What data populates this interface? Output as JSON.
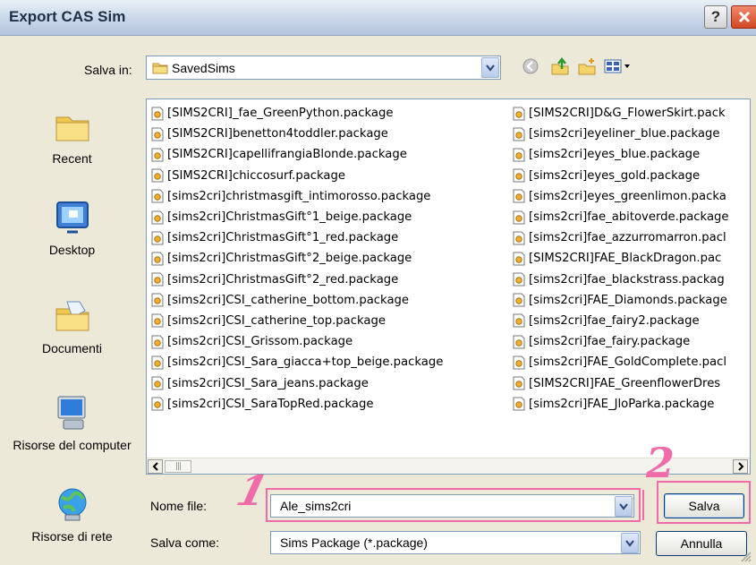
{
  "window": {
    "title": "Export CAS Sim",
    "help_label": "?",
    "close_label": "✕"
  },
  "save_in": {
    "label": "Salva in:",
    "value": "SavedSims"
  },
  "nav_icons": [
    "back-icon",
    "up-folder-icon",
    "new-folder-icon",
    "views-menu-icon"
  ],
  "places": [
    {
      "id": "recent",
      "label": "Recent",
      "icon": "recent-folder-icon"
    },
    {
      "id": "desktop",
      "label": "Desktop",
      "icon": "desktop-icon"
    },
    {
      "id": "documenti",
      "label": "Documenti",
      "icon": "documents-folder-icon"
    },
    {
      "id": "computer",
      "label": "Risorse del computer",
      "icon": "my-computer-icon"
    },
    {
      "id": "network",
      "label": "Risorse di rete",
      "icon": "network-places-icon"
    }
  ],
  "files_column1": [
    "[SIMS2CRI]_fae_GreenPython.package",
    "[SIMS2CRI]benetton4toddler.package",
    "[SIMS2CRI]capellifrangiaBlonde.package",
    "[SIMS2CRI]chiccosurf.package",
    "[sims2cri]christmasgift_intimorosso.package",
    "[sims2cri]ChristmasGift°1_beige.package",
    "[sims2cri]ChristmasGift°1_red.package",
    "[sims2cri]ChristmasGift°2_beige.package",
    "[sims2cri]ChristmasGift°2_red.package",
    "[sims2cri]CSI_catherine_bottom.package",
    "[sims2cri]CSI_catherine_top.package",
    "[sims2cri]CSI_Grissom.package",
    "[sims2cri]CSI_Sara_giacca+top_beige.package",
    "[sims2cri]CSI_Sara_jeans.package",
    "[sims2cri]CSI_SaraTopRed.package"
  ],
  "files_column2": [
    "[SIMS2CRI]D&G_FlowerSkirt.pack",
    "[sims2cri]eyeliner_blue.package",
    "[sims2cri]eyes_blue.package",
    "[sims2cri]eyes_gold.package",
    "[sims2cri]eyes_greenlimon.packa",
    "[sims2cri]fae_abitoverde.package",
    "[sims2cri]fae_azzurromarron.pacl",
    "[SIMS2CRI]FAE_BlackDragon.pac",
    "[sims2cri]fae_blackstrass.packag",
    "[sims2cri]FAE_Diamonds.package",
    "[sims2cri]fae_fairy2.package",
    "[sims2cri]fae_fairy.package",
    "[sims2cri]FAE_GoldComplete.pacl",
    "[SIMS2CRI]FAE_GreenflowerDres",
    "[sims2cri]FAE_JloParka.package"
  ],
  "scrollbar": {
    "thumb_glyph": "|||",
    "left_arrow": "<",
    "right_arrow": ">"
  },
  "filename": {
    "label": "Nome file:",
    "value": "Ale_sims2cri"
  },
  "savetype": {
    "label": "Salva come:",
    "value": "Sims Package (*.package)"
  },
  "buttons": {
    "save": "Salva",
    "cancel": "Annulla"
  },
  "annotations": {
    "mark1": "1",
    "mark2": "2",
    "color": "#f06ca8"
  },
  "colors": {
    "accent": "#003c74",
    "field_border": "#7f9db9",
    "dialog_bg": "#ece9d8"
  }
}
